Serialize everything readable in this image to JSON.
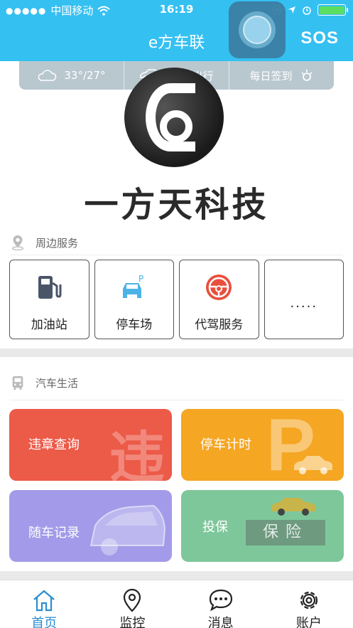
{
  "status": {
    "carrier": "中国移动",
    "time": "16:19"
  },
  "header": {
    "title": "e方车联",
    "sos": "SOS"
  },
  "infobar": {
    "weather": "33°/27°",
    "travel": "适宜出行",
    "checkin": "每日签到"
  },
  "logo": {
    "name": "一方天科技"
  },
  "nearby": {
    "title": "周边服务",
    "items": [
      {
        "label": "加油站",
        "icon": "gas-station-icon"
      },
      {
        "label": "停车场",
        "icon": "parking-car-icon"
      },
      {
        "label": "代驾服务",
        "icon": "steering-wheel-icon"
      },
      {
        "label": "",
        "icon": "more-icon",
        "more_text": "....."
      }
    ]
  },
  "carlife": {
    "title": "汽车生活",
    "cards": [
      {
        "label": "违章查询",
        "color": "#ec5a48",
        "deco_text": "违"
      },
      {
        "label": "停车计时",
        "color": "#f5a623",
        "deco_text": "P"
      },
      {
        "label": "随车记录",
        "color": "#a39be9"
      },
      {
        "label": "投保",
        "color": "#7ec79b",
        "deco_text": "保险"
      }
    ]
  },
  "bottomnav": {
    "items": [
      {
        "label": "首页",
        "icon": "home-icon",
        "active": true
      },
      {
        "label": "监控",
        "icon": "location-pin-icon"
      },
      {
        "label": "消息",
        "icon": "chat-bubble-icon"
      },
      {
        "label": "账户",
        "icon": "gear-icon"
      }
    ]
  },
  "colors": {
    "header_bg": "#35c0f2",
    "active_nav": "#2a8ed0"
  }
}
